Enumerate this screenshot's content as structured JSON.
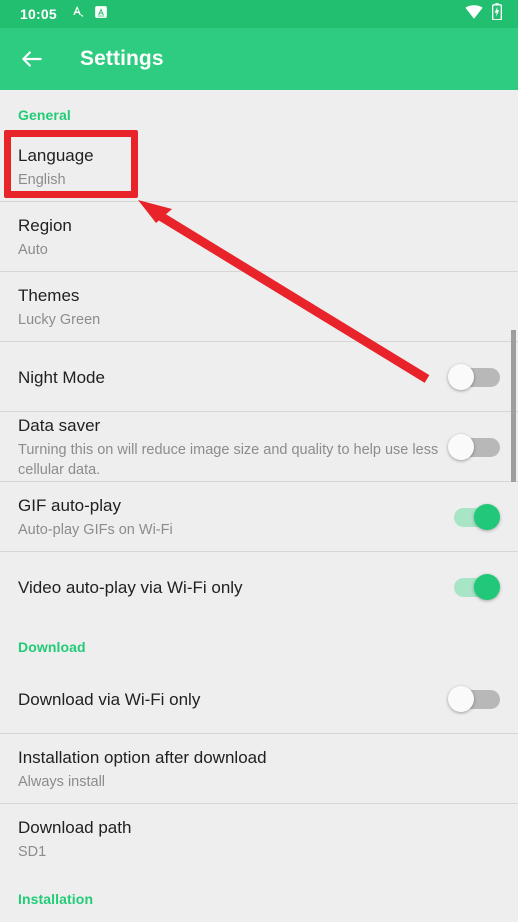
{
  "status_bar": {
    "time": "10:05",
    "left_icons": [
      "translate-notification-icon",
      "app-notification-icon"
    ],
    "right_icons": [
      "wifi-icon",
      "battery-charging-icon"
    ],
    "background_color": "#23bf70"
  },
  "app_bar": {
    "back_label": "back-arrow",
    "title": "Settings",
    "background_color": "#2ecc80"
  },
  "accent_color": "#22cc77",
  "annotation_color": "#e8232a",
  "sections": [
    {
      "header": "General",
      "rows": [
        {
          "title": "Language",
          "subtitle": "English",
          "control": "none",
          "highlighted": true
        },
        {
          "title": "Region",
          "subtitle": "Auto",
          "control": "none"
        },
        {
          "title": "Themes",
          "subtitle": "Lucky Green",
          "control": "none"
        },
        {
          "title": "Night Mode",
          "subtitle": "",
          "control": "toggle",
          "toggle_on": false
        },
        {
          "title": "Data saver",
          "subtitle": "Turning this on will reduce image size and quality to help use less cellular data.",
          "control": "toggle",
          "toggle_on": false
        },
        {
          "title": "GIF auto-play",
          "subtitle": "Auto-play GIFs on Wi-Fi",
          "control": "toggle",
          "toggle_on": true
        },
        {
          "title": "Video auto-play via Wi-Fi only",
          "subtitle": "",
          "control": "toggle",
          "toggle_on": true
        }
      ]
    },
    {
      "header": "Download",
      "rows": [
        {
          "title": "Download via Wi-Fi only",
          "subtitle": "",
          "control": "toggle",
          "toggle_on": false
        },
        {
          "title": "Installation option after download",
          "subtitle": "Always install",
          "control": "none"
        },
        {
          "title": "Download path",
          "subtitle": "SD1",
          "control": "none"
        }
      ]
    },
    {
      "header": "Installation",
      "rows": []
    }
  ]
}
